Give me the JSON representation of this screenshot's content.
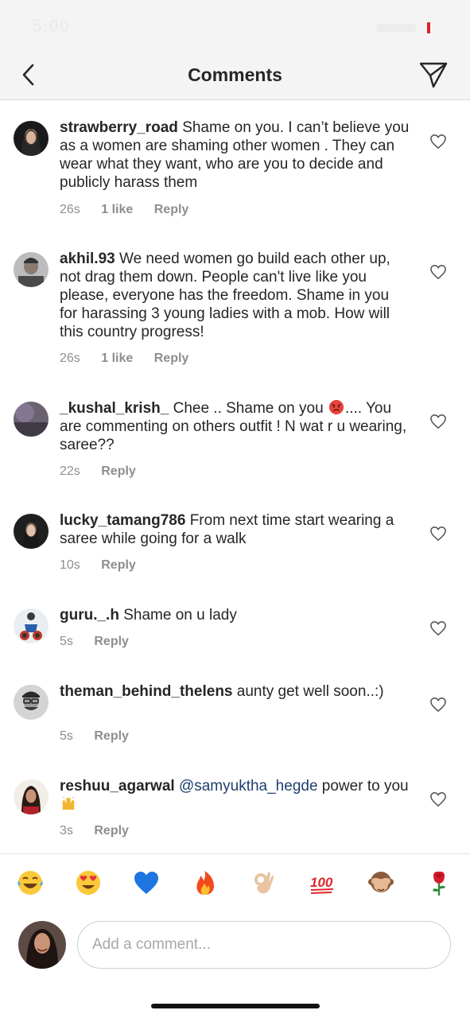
{
  "status_bar": {
    "time": "5:00"
  },
  "nav": {
    "title": "Comments"
  },
  "comments": [
    {
      "username": "strawberry_road",
      "text": "Shame on you. I can’t believe you as a women are shaming other women . They can wear what they want, who are you to decide and publicly harass them",
      "time": "26s",
      "likes": "1 like",
      "reply": "Reply"
    },
    {
      "username": "akhil.93",
      "text": "We need women go build each other up, not drag them down. People can't live like you please, everyone has the freedom. Shame in you for harassing 3 young ladies with a mob. How will this country progress!",
      "time": "26s",
      "likes": "1 like",
      "reply": "Reply"
    },
    {
      "username": "_kushal_krish_",
      "text_before": "Chee .. Shame on you",
      "emoji": "angry-face",
      "text_after": ".... You are commenting on others outfit ! N wat r u wearing, saree??",
      "time": "22s",
      "reply": "Reply"
    },
    {
      "username": "lucky_tamang786",
      "text": "From next time start wearing a saree while going for a walk",
      "time": "10s",
      "reply": "Reply"
    },
    {
      "username": "guru._.h",
      "text": "Shame on u lady",
      "time": "5s",
      "reply": "Reply"
    },
    {
      "username": "theman_behind_thelens",
      "text": "aunty get well soon..:)",
      "time": "5s",
      "reply": "Reply"
    },
    {
      "username": "reshuu_agarwal",
      "mention": "@samyuktha_hegde",
      "text": "power to you",
      "emoji": "raising-hands",
      "time": "3s",
      "reply": "Reply"
    }
  ],
  "emoji_bar": [
    "face-with-tears-of-joy",
    "smiling-face-with-heart-eyes",
    "blue-heart",
    "fire",
    "ok-hand",
    "hundred-points",
    "see-no-evil-monkey",
    "rose"
  ],
  "composer": {
    "placeholder": "Add a comment..."
  },
  "colors": {
    "accent_mention": "#1e3f6e",
    "meta_gray": "#8e8e8e",
    "battery_red": "#e0202c"
  }
}
